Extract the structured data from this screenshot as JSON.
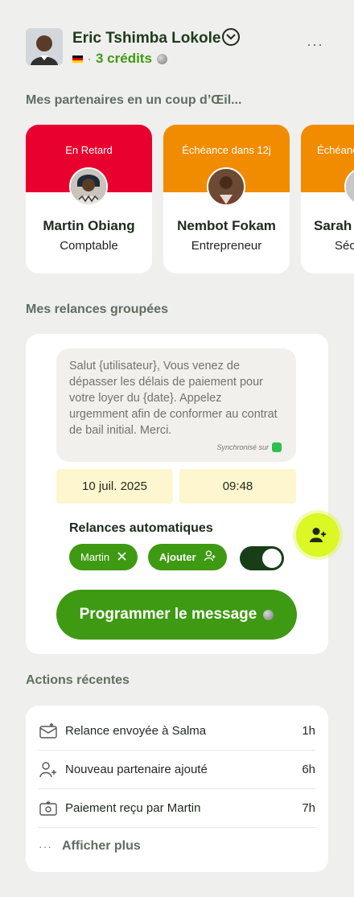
{
  "user": {
    "name": "Eric Tshimba Lokole",
    "credits": "3 crédits",
    "separator": "·"
  },
  "partners": {
    "title": "Mes partenaires en un coup d’Œil...",
    "items": [
      {
        "status": "En Retard",
        "status_color": "#e8002f",
        "name": "Martin Obiang",
        "role": "Comptable"
      },
      {
        "status": "Échéance dans 12j",
        "status_color": "#f18c00",
        "name": "Nembot Fokam",
        "role": "Entrepreneur"
      },
      {
        "status": "Échéance",
        "status_color": "#f18c00",
        "name": "Sarah",
        "role": "Séc"
      }
    ]
  },
  "reminders": {
    "title": "Mes relances groupées",
    "message": "Salut {utilisateur}, Vous venez de dépasser les délais de paiement pour votre loyer du  {date}. Appelez urgemment afin de  conformer au contrat de bail initial. Merci.",
    "sync_label": "Synchronisé sur",
    "date": "10 juil. 2025",
    "time": "09:48",
    "auto_title": "Relances automatiques",
    "chip_martin": "Martin",
    "chip_add": "Ajouter",
    "toggle_on": true,
    "cta": "Programmer le message"
  },
  "recent": {
    "title": "Actions récentes",
    "items": [
      {
        "icon": "mail-send-icon",
        "label": "Relance envoyée à Salma",
        "time": "1h"
      },
      {
        "icon": "user-add-icon",
        "label": "Nouveau partenaire ajouté",
        "time": "6h"
      },
      {
        "icon": "money-icon",
        "label": "Paiement reçu par Martin",
        "time": "7h"
      }
    ],
    "more": "Afficher plus"
  },
  "colors": {
    "accent": "#3e9a12",
    "late": "#e8002f",
    "due": "#f18c00",
    "fab": "#dbf724"
  }
}
